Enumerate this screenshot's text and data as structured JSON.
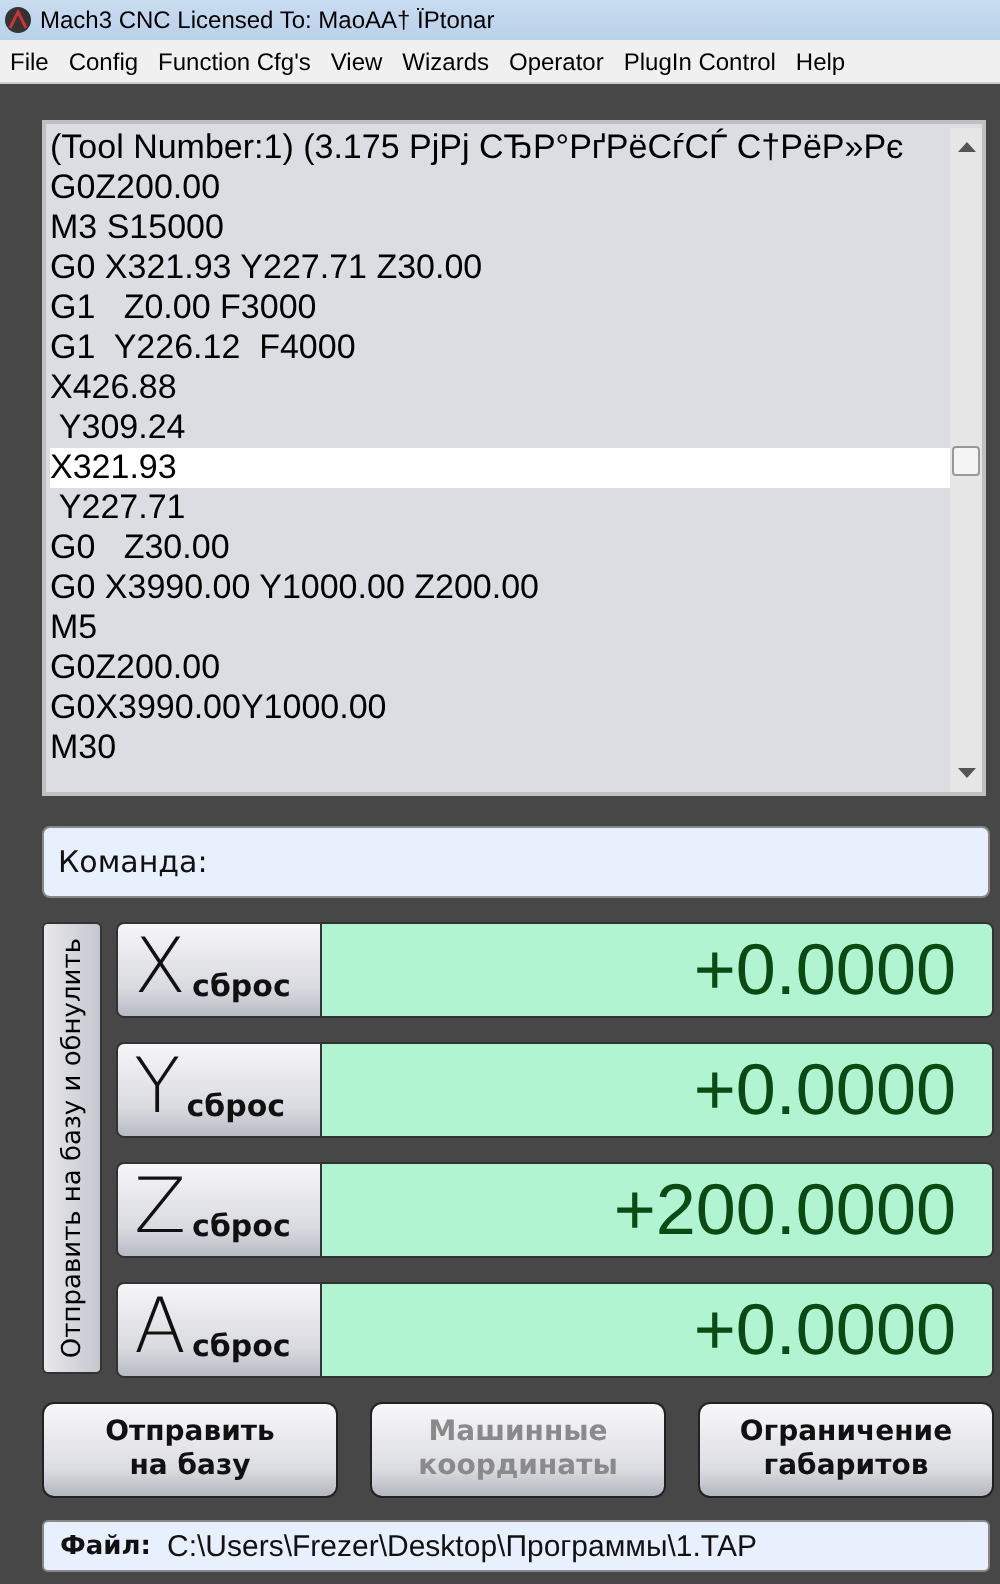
{
  "window": {
    "title": "Mach3 CNC  Licensed To: MaoAA† ÏPtonar"
  },
  "menu": [
    "File",
    "Config",
    "Function Cfg's",
    "View",
    "Wizards",
    "Operator",
    "PlugIn Control",
    "Help"
  ],
  "gcode": {
    "lines": [
      {
        "text": "(Tool Number:1) (3.175 PjPj CЂP°PґPëCѓCЃ C†PëP»Pє",
        "selected": false
      },
      {
        "text": "G0Z200.00",
        "selected": false
      },
      {
        "text": "M3 S15000",
        "selected": false
      },
      {
        "text": "G0 X321.93 Y227.71 Z30.00",
        "selected": false
      },
      {
        "text": "G1   Z0.00 F3000",
        "selected": false
      },
      {
        "text": "G1  Y226.12  F4000",
        "selected": false
      },
      {
        "text": "X426.88",
        "selected": false
      },
      {
        "text": " Y309.24",
        "selected": false
      },
      {
        "text": "X321.93",
        "selected": true
      },
      {
        "text": " Y227.71",
        "selected": false
      },
      {
        "text": "G0   Z30.00",
        "selected": false
      },
      {
        "text": "G0 X3990.00 Y1000.00 Z200.00",
        "selected": false
      },
      {
        "text": "M5",
        "selected": false
      },
      {
        "text": "G0Z200.00",
        "selected": false
      },
      {
        "text": "G0X3990.00Y1000.00",
        "selected": false
      },
      {
        "text": "M30",
        "selected": false
      }
    ]
  },
  "command": {
    "label": "Команда:"
  },
  "home_zero_button": "Отправить на базу и обнулить",
  "axes": [
    {
      "letter": "X",
      "reset": "сброс",
      "value": "+0.0000"
    },
    {
      "letter": "Y",
      "reset": "сброс",
      "value": "+0.0000"
    },
    {
      "letter": "Z",
      "reset": "сброс",
      "value": "+200.0000"
    },
    {
      "letter": "A",
      "reset": "сброс",
      "value": "+0.0000"
    }
  ],
  "buttons": [
    {
      "lines": [
        "Отправить",
        "на базу"
      ],
      "disabled": false
    },
    {
      "lines": [
        "Машинные",
        "координаты"
      ],
      "disabled": true
    },
    {
      "lines": [
        "Ограничение",
        "габаритов"
      ],
      "disabled": false
    }
  ],
  "file": {
    "label": "Файл:",
    "path": "C:\\Users\\Frezer\\Desktop\\Программы\\1.TAP"
  }
}
